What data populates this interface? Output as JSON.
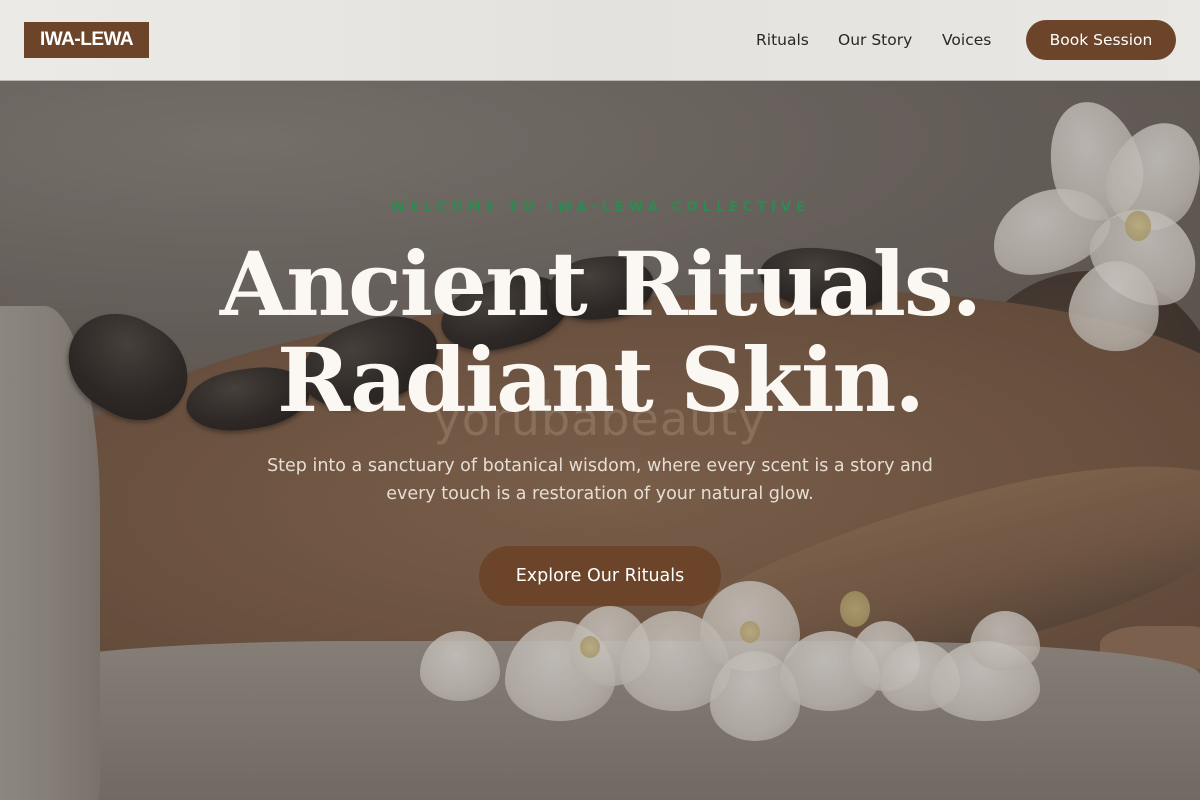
{
  "header": {
    "logo": "IWA-LEWA",
    "nav": [
      {
        "label": "Rituals"
      },
      {
        "label": "Our Story"
      },
      {
        "label": "Voices"
      }
    ],
    "cta_label": "Book Session"
  },
  "hero": {
    "eyebrow": "WELCOME TO IWA-LEWA COLLECTIVE",
    "headline_line1": "Ancient Rituals.",
    "headline_line2": "Radiant Skin.",
    "watermark_text": "yorubabeauty",
    "subtext": "Step into a sanctuary of botanical wisdom, where every scent is a story and every touch is a restoration of your natural glow.",
    "cta_label": "Explore Our Rituals",
    "image_alt": "spa-massage-hot-stones-orchids"
  },
  "colors": {
    "brand_brown": "#6b4429",
    "eyebrow_green": "#2f8a52",
    "header_bg": "#e8e6e2",
    "headline_text": "#fbf8f3"
  }
}
